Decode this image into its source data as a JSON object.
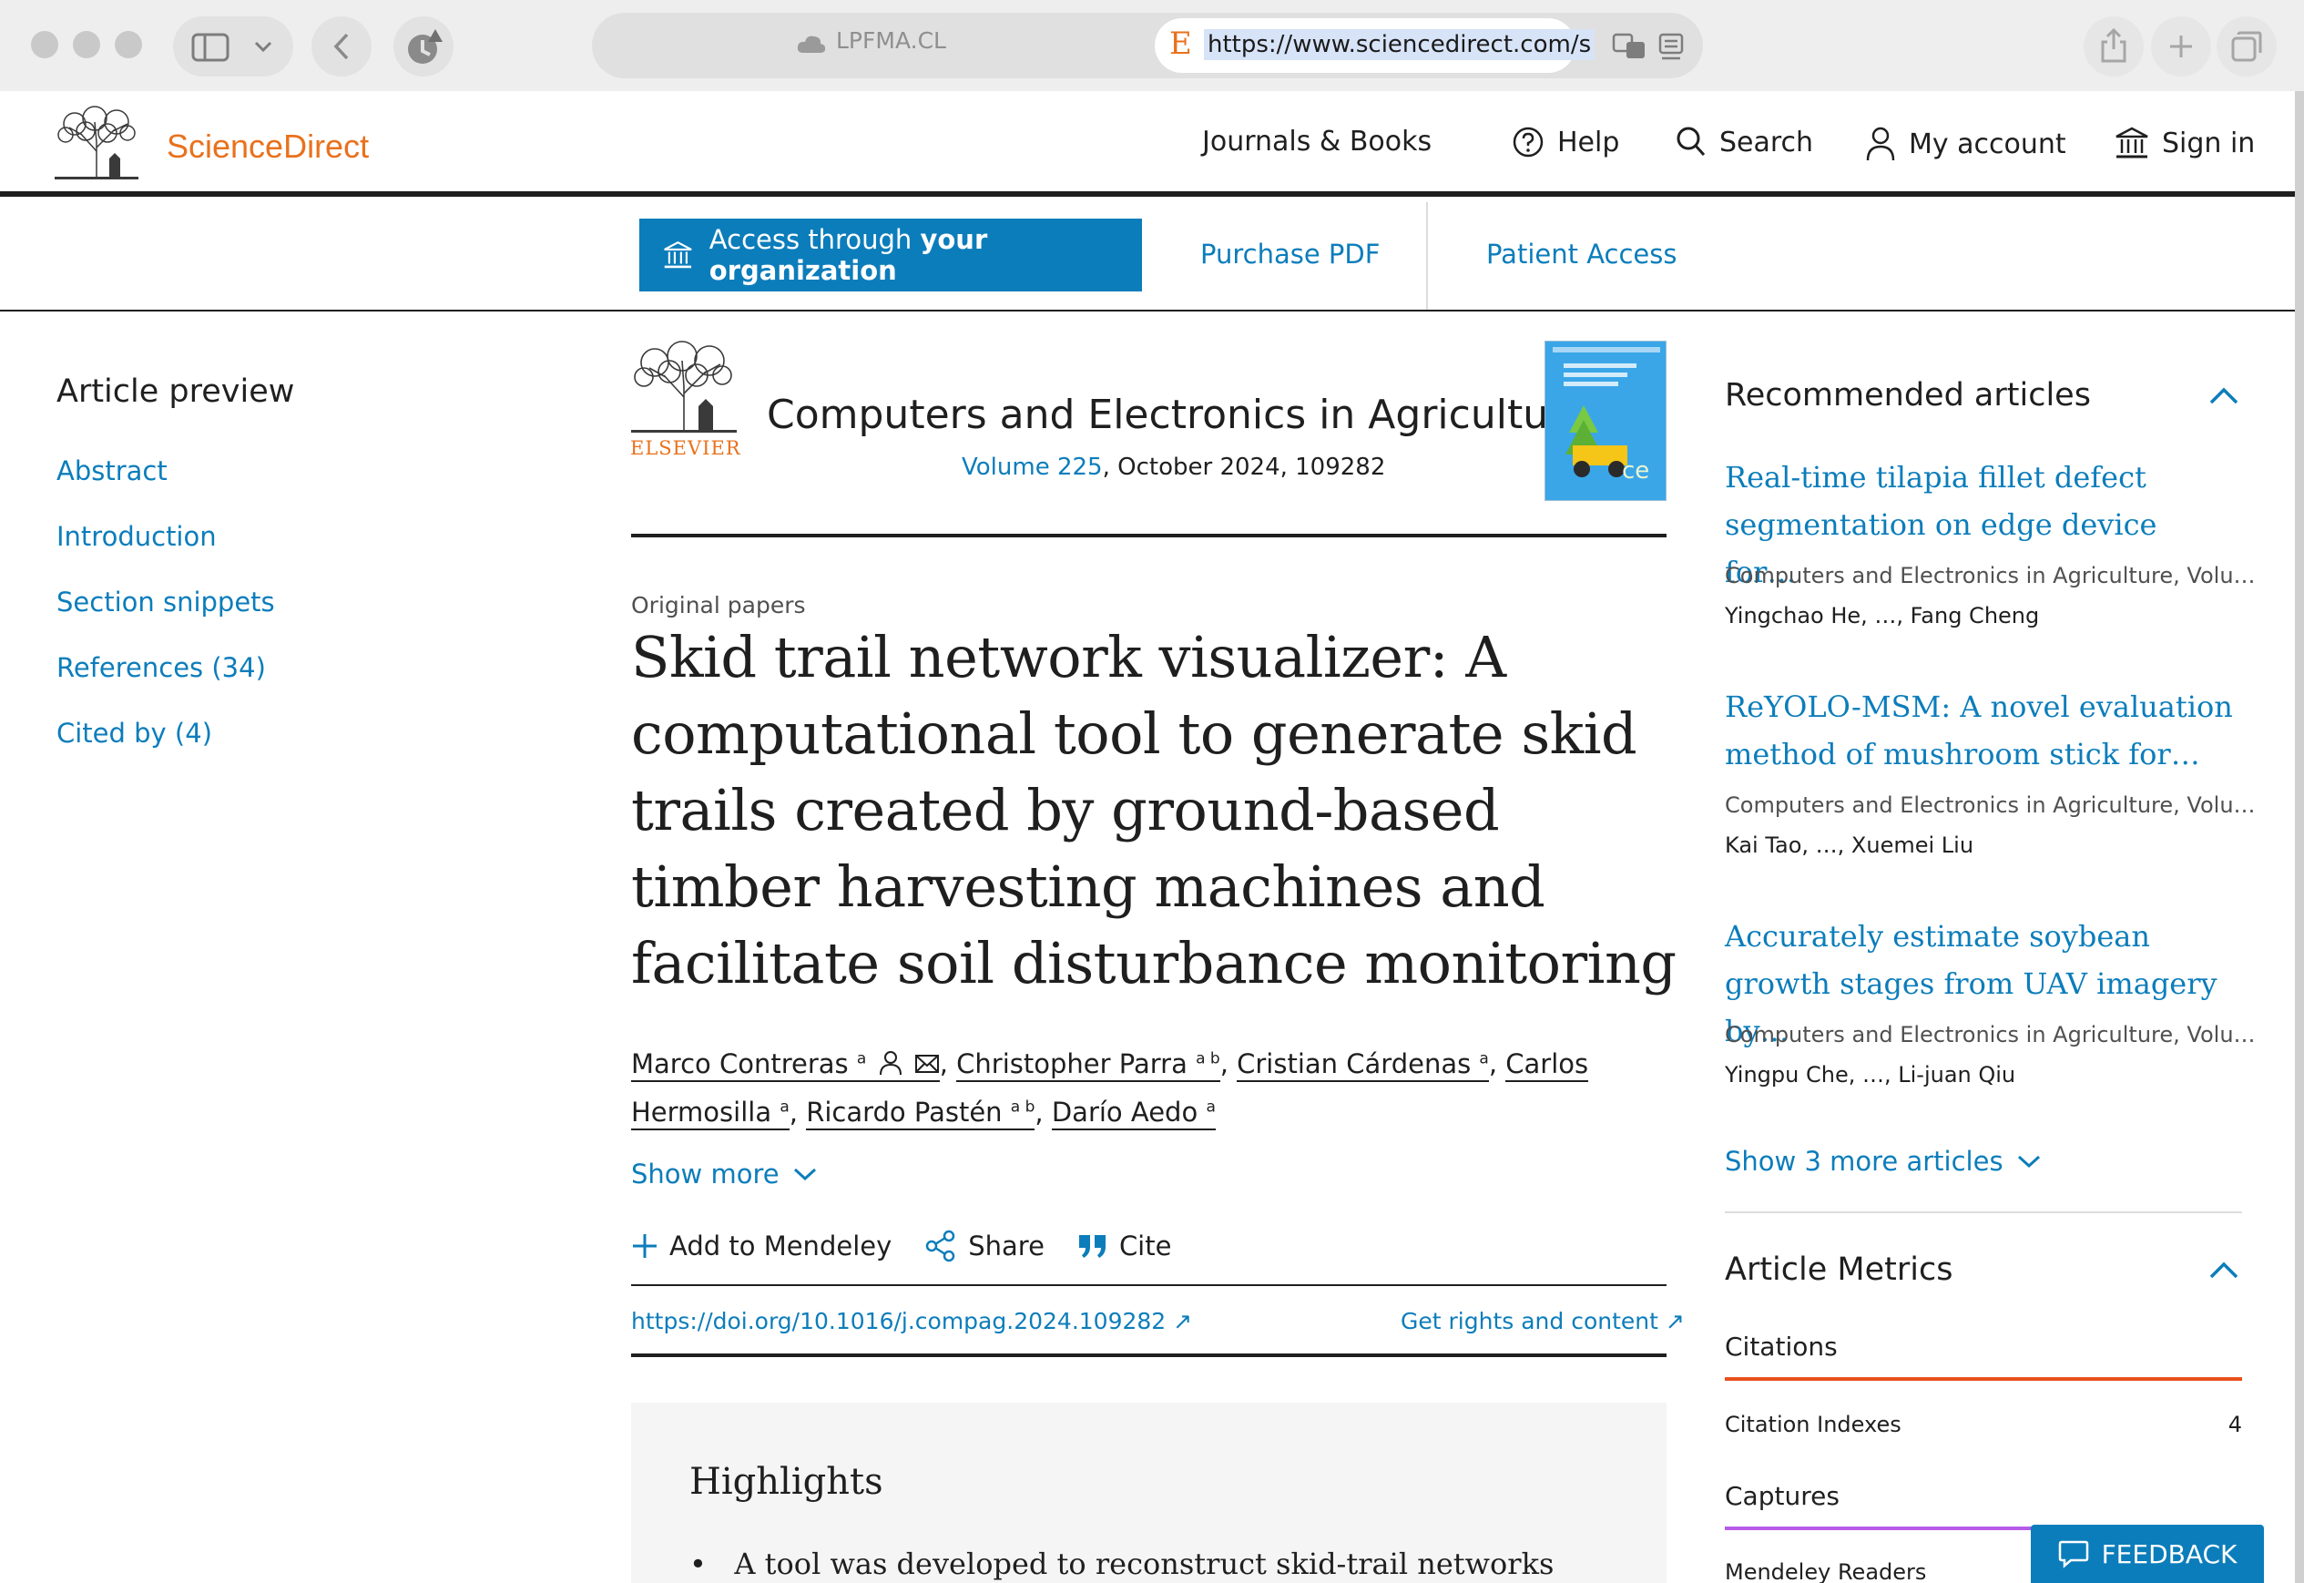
{
  "browser": {
    "inactive_tab": "LPFMA.CL",
    "url": "https://www.sciencedirect.com/s"
  },
  "header": {
    "brand": "ScienceDirect",
    "nav": {
      "journals": "Journals & Books",
      "help": "Help",
      "search": "Search",
      "account": "My account",
      "signin": "Sign in"
    }
  },
  "access": {
    "access_prefix": "Access through",
    "access_bold": "your organization",
    "purchase": "Purchase PDF",
    "patient": "Patient Access"
  },
  "toc": {
    "title": "Article preview",
    "items": [
      "Abstract",
      "Introduction",
      "Section snippets",
      "References (34)",
      "Cited by (4)"
    ]
  },
  "journal": {
    "publisher": "ELSEVIER",
    "title": "Computers and Electronics in Agriculture",
    "volume_link": "Volume 225",
    "volume_rest": ", October 2024, 109282"
  },
  "article": {
    "type": "Original papers",
    "title": "Skid trail network visualizer: A computational tool to generate skid trails created by ground-based timber harvesting machines and facilitate soil disturbance monitoring",
    "authors": [
      {
        "name": "Marco Contreras",
        "sup": "a"
      },
      {
        "name": "Christopher Parra",
        "sup": "a b"
      },
      {
        "name": "Cristian Cárdenas",
        "sup": "a"
      },
      {
        "name": "Carlos Hermosilla",
        "sup": "a"
      },
      {
        "name": "Ricardo Pastén",
        "sup": "a b"
      },
      {
        "name": "Darío Aedo",
        "sup": "a"
      }
    ],
    "show_more": "Show more",
    "actions": {
      "mendeley": "Add to Mendeley",
      "share": "Share",
      "cite": "Cite"
    },
    "doi": "https://doi.org/10.1016/j.compag.2024.109282",
    "rights": "Get rights and content"
  },
  "highlights": {
    "title": "Highlights",
    "first_item": "A tool was developed to reconstruct skid-trail networks"
  },
  "recommended": {
    "title": "Recommended articles",
    "items": [
      {
        "title": "Real-time tilapia fillet defect segmentation on edge device for…",
        "journal": "Computers and Electronics in Agriculture, Volu…",
        "authors": "Yingchao He, …, Fang Cheng"
      },
      {
        "title": "ReYOLO-MSM: A novel evaluation method of mushroom stick for…",
        "journal": "Computers and Electronics in Agriculture, Volu…",
        "authors": "Kai Tao, …, Xuemei Liu"
      },
      {
        "title": "Accurately estimate soybean growth stages from UAV imagery by…",
        "journal": "Computers and Electronics in Agriculture, Volu…",
        "authors": "Yingpu Che, …, Li-juan Qiu"
      }
    ],
    "show_more": "Show 3 more articles"
  },
  "metrics": {
    "title": "Article Metrics",
    "citations_label": "Citations",
    "citation_indexes_label": "Citation Indexes",
    "citation_indexes_value": "4",
    "captures_label": "Captures",
    "mendeley_readers_label": "Mendeley Readers",
    "citations_color": "#e9511c",
    "captures_color": "#b65be8"
  },
  "feedback": "FEEDBACK",
  "colors": {
    "brand_orange": "#e9711c",
    "link_blue": "#0c7dbb",
    "text_dark": "#1f1f1f"
  }
}
